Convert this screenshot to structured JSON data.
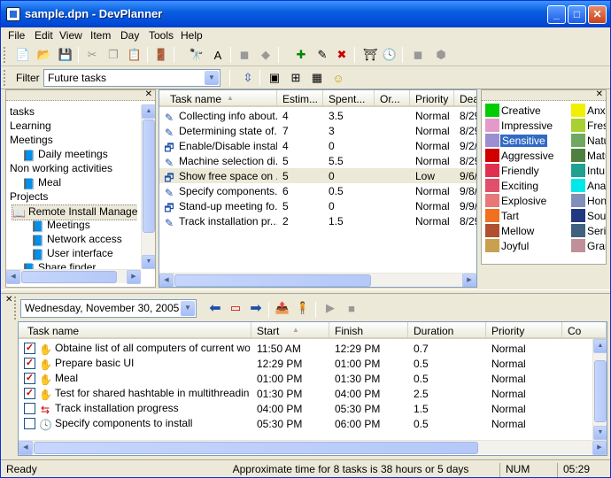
{
  "window": {
    "title": "sample.dpn - DevPlanner"
  },
  "menu": [
    "File",
    "Edit",
    "View",
    "Item",
    "Day",
    "Tools",
    "Help"
  ],
  "filter": {
    "label": "Filter",
    "value": "Future tasks"
  },
  "tree": {
    "items": [
      {
        "label": "tasks",
        "icon": ""
      },
      {
        "label": "Learning",
        "icon": ""
      },
      {
        "label": "Meetings",
        "icon": ""
      },
      {
        "label": "Daily meetings",
        "icon": "book-icon"
      },
      {
        "label": "Non working activities",
        "icon": ""
      },
      {
        "label": "Meal",
        "icon": "book-icon"
      },
      {
        "label": "Projects",
        "icon": ""
      },
      {
        "label": "Remote Install Manager",
        "icon": "open-book-icon"
      },
      {
        "label": "Meetings",
        "icon": "book-icon"
      },
      {
        "label": "Network access",
        "icon": "book-icon"
      },
      {
        "label": "User interface",
        "icon": "book-icon"
      },
      {
        "label": "Share finder",
        "icon": "book-icon"
      }
    ]
  },
  "tasklist": {
    "columns": [
      "Task name",
      "Estim...",
      "Spent...",
      "Or...",
      "Priority",
      "Dea"
    ],
    "rows": [
      {
        "icon": "pencil-icon",
        "name": "Collecting info about...",
        "estim": "4",
        "spent": "3.5",
        "or": "",
        "priority": "Normal",
        "dea": "8/29"
      },
      {
        "icon": "pencil-icon",
        "name": "Determining state of...",
        "estim": "7",
        "spent": "3",
        "or": "",
        "priority": "Normal",
        "dea": "8/29"
      },
      {
        "icon": "edit-window-icon",
        "name": "Enable/Disable instal...",
        "estim": "4",
        "spent": "0",
        "or": "",
        "priority": "Normal",
        "dea": "9/2/"
      },
      {
        "icon": "pencil-icon",
        "name": "Machine selection di...",
        "estim": "5",
        "spent": "5.5",
        "or": "",
        "priority": "Normal",
        "dea": "8/29"
      },
      {
        "icon": "edit-window-icon",
        "name": "Show free space on ...",
        "estim": "5",
        "spent": "0",
        "or": "",
        "priority": "Low",
        "dea": "9/6/"
      },
      {
        "icon": "pencil-icon",
        "name": "Specify components...",
        "estim": "6",
        "spent": "0.5",
        "or": "",
        "priority": "Normal",
        "dea": "9/8/"
      },
      {
        "icon": "edit-window-icon",
        "name": "Stand-up meeting fo...",
        "estim": "5",
        "spent": "0",
        "or": "",
        "priority": "Normal",
        "dea": "9/9/"
      },
      {
        "icon": "pencil-icon",
        "name": "Track installation pr...",
        "estim": "2",
        "spent": "1.5",
        "or": "",
        "priority": "Normal",
        "dea": "8/29"
      }
    ]
  },
  "categories": {
    "left": [
      {
        "label": "Creative",
        "color": "#00cc00"
      },
      {
        "label": "Impressive",
        "color": "#e39ac8"
      },
      {
        "label": "Sensitive",
        "color": "#9b8fd1"
      },
      {
        "label": "Aggressive",
        "color": "#d10000"
      },
      {
        "label": "Friendly",
        "color": "#e03050"
      },
      {
        "label": "Exciting",
        "color": "#e0506a"
      },
      {
        "label": "Explosive",
        "color": "#e87878"
      },
      {
        "label": "Tart",
        "color": "#f07020"
      },
      {
        "label": "Mellow",
        "color": "#b05030"
      },
      {
        "label": "Joyful",
        "color": "#c8a050"
      }
    ],
    "right": [
      {
        "label": "Anx",
        "color": "#f0f000"
      },
      {
        "label": "Fres",
        "color": "#a8d030"
      },
      {
        "label": "Natu",
        "color": "#70a860"
      },
      {
        "label": "Matu",
        "color": "#508040"
      },
      {
        "label": "Intu",
        "color": "#20a090"
      },
      {
        "label": "Ana",
        "color": "#00e8e8"
      },
      {
        "label": "Hon",
        "color": "#8090b8"
      },
      {
        "label": "Soul",
        "color": "#203880"
      },
      {
        "label": "Seric",
        "color": "#406080"
      },
      {
        "label": "Grar",
        "color": "#c09098"
      }
    ]
  },
  "schedule": {
    "date": "Wednesday, November 30, 2005",
    "columns": [
      "Task name",
      "Start",
      "Finish",
      "Duration",
      "Priority",
      "Co"
    ],
    "rows": [
      {
        "checked": true,
        "icon": "hand-icon",
        "name": "Obtaine list of all computers of current wor...",
        "start": "11:50 AM",
        "finish": "12:29 PM",
        "duration": "0.7",
        "priority": "Normal"
      },
      {
        "checked": true,
        "icon": "hand-icon",
        "name": "Prepare basic UI",
        "start": "12:29 PM",
        "finish": "01:00 PM",
        "duration": "0.5",
        "priority": "Normal"
      },
      {
        "checked": true,
        "icon": "hand-icon",
        "name": "Meal",
        "start": "01:00 PM",
        "finish": "01:30 PM",
        "duration": "0.5",
        "priority": "Normal"
      },
      {
        "checked": true,
        "icon": "hand-icon",
        "name": "Test for shared hashtable in multithreading",
        "start": "01:30 PM",
        "finish": "04:00 PM",
        "duration": "2.5",
        "priority": "Normal"
      },
      {
        "checked": false,
        "icon": "progress-icon",
        "name": "Track installation progress",
        "start": "04:00 PM",
        "finish": "05:30 PM",
        "duration": "1.5",
        "priority": "Normal"
      },
      {
        "checked": false,
        "icon": "clock-icon",
        "name": "Specify components to install",
        "start": "05:30 PM",
        "finish": "06:00 PM",
        "duration": "0.5",
        "priority": "Normal"
      }
    ]
  },
  "status": {
    "ready": "Ready",
    "summary": "Approximate time for 8 tasks is 38 hours or 5 days",
    "num": "NUM",
    "time": "05:29"
  }
}
